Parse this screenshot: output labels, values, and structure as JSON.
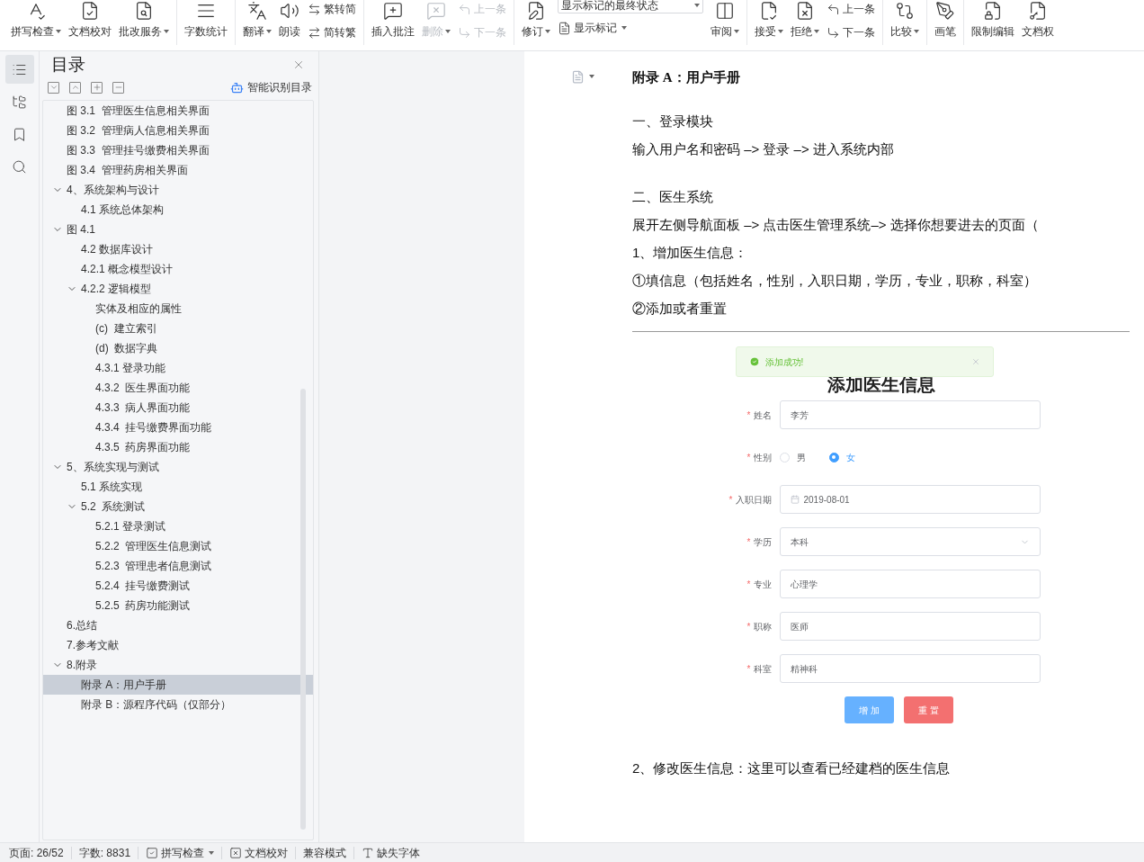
{
  "toolbar": [
    {
      "kind": "button",
      "label": "拼写检查",
      "dropdown": true,
      "disabled": false
    },
    {
      "kind": "button",
      "label": "文档校对",
      "dropdown": false,
      "disabled": false
    },
    {
      "kind": "button",
      "label": "批改服务",
      "dropdown": true,
      "disabled": false
    },
    {
      "kind": "separator"
    },
    {
      "kind": "button",
      "label": "字数统计",
      "dropdown": false,
      "disabled": false
    },
    {
      "kind": "separator"
    },
    {
      "kind": "button",
      "label": "翻译",
      "dropdown": true,
      "disabled": false
    },
    {
      "kind": "button",
      "label": "朗读",
      "dropdown": false,
      "disabled": false
    },
    {
      "kind": "stack",
      "rows": [
        {
          "kind": "small",
          "label": "繁转简",
          "dropdown": false,
          "disabled": false
        },
        {
          "kind": "small",
          "label": "简转繁",
          "dropdown": false,
          "disabled": false
        }
      ]
    },
    {
      "kind": "separator"
    },
    {
      "kind": "button",
      "label": "插入批注",
      "dropdown": false,
      "disabled": false
    },
    {
      "kind": "button",
      "label": "删除",
      "dropdown": true,
      "disabled": true
    },
    {
      "kind": "stack",
      "rows": [
        {
          "kind": "small",
          "label": "上一条",
          "dropdown": false,
          "disabled": true
        },
        {
          "kind": "small",
          "label": "下一条",
          "dropdown": false,
          "disabled": true
        }
      ]
    },
    {
      "kind": "separator"
    },
    {
      "kind": "button",
      "label": "修订",
      "dropdown": true,
      "disabled": false
    },
    {
      "kind": "stack",
      "rows": [
        {
          "kind": "select",
          "value": "显示标记的最终状态"
        },
        {
          "kind": "small",
          "label": "显示标记",
          "dropdown": true,
          "disabled": false
        }
      ]
    },
    {
      "kind": "button",
      "label": "审阅",
      "dropdown": true,
      "disabled": false
    },
    {
      "kind": "separator"
    },
    {
      "kind": "button",
      "label": "接受",
      "dropdown": true,
      "disabled": false
    },
    {
      "kind": "button",
      "label": "拒绝",
      "dropdown": true,
      "disabled": false
    },
    {
      "kind": "stack",
      "rows": [
        {
          "kind": "small",
          "label": "上一条",
          "dropdown": false,
          "disabled": false
        },
        {
          "kind": "small",
          "label": "下一条",
          "dropdown": false,
          "disabled": false
        }
      ]
    },
    {
      "kind": "separator"
    },
    {
      "kind": "button",
      "label": "比较",
      "dropdown": true,
      "disabled": false
    },
    {
      "kind": "separator"
    },
    {
      "kind": "button",
      "label": "画笔",
      "dropdown": false,
      "disabled": false
    },
    {
      "kind": "separator"
    },
    {
      "kind": "button",
      "label": "限制编辑",
      "dropdown": false,
      "disabled": false
    },
    {
      "kind": "button",
      "label": "文档权",
      "dropdown": false,
      "disabled": false
    }
  ],
  "rail": [
    {
      "selected": true
    },
    {
      "selected": false
    },
    {
      "selected": false
    },
    {
      "selected": false
    }
  ],
  "nav": {
    "title": "目录",
    "smart_link": "智能识别目录",
    "tree": [
      {
        "children": [
          {
            "label": "图 3.1  管理医生信息相关界面",
            "selected": false
          },
          {
            "label": "图 3.2  管理病人信息相关界面",
            "selected": false
          },
          {
            "label": "图 3.3  管理挂号缴费相关界面",
            "selected": false
          },
          {
            "label": "图 3.4  管理药房相关界面",
            "selected": false
          }
        ]
      },
      {
        "label": "4、系统架构与设计",
        "selected": false,
        "expanded": true,
        "children": [
          {
            "label": "4.1 系统总体架构",
            "selected": false
          }
        ]
      },
      {
        "label": "图 4.1",
        "selected": false,
        "expanded": true,
        "children": [
          {
            "label": "4.2 数据库设计",
            "selected": false
          },
          {
            "label": "4.2.1 概念模型设计",
            "selected": false
          },
          {
            "label": "4.2.2 逻辑模型",
            "selected": false,
            "expanded": true,
            "children": [
              {
                "label": "实体及相应的属性",
                "selected": false
              },
              {
                "label": "(c)  建立索引",
                "selected": false
              },
              {
                "label": "(d)  数据字典",
                "selected": false
              },
              {
                "label": "4.3.1 登录功能",
                "selected": false
              },
              {
                "label": "4.3.2  医生界面功能",
                "selected": false
              },
              {
                "label": "4.3.3  病人界面功能",
                "selected": false
              },
              {
                "label": "4.3.4  挂号缴费界面功能",
                "selected": false
              },
              {
                "label": "4.3.5  药房界面功能",
                "selected": false
              }
            ]
          }
        ]
      },
      {
        "label": "5、系统实现与测试",
        "selected": false,
        "expanded": true,
        "children": [
          {
            "label": "5.1 系统实现",
            "selected": false
          },
          {
            "label": "5.2  系统测试",
            "selected": false,
            "expanded": true,
            "children": [
              {
                "label": "5.2.1 登录测试",
                "selected": false
              },
              {
                "label": "5.2.2  管理医生信息测试",
                "selected": false
              },
              {
                "label": "5.2.3  管理患者信息测试",
                "selected": false
              },
              {
                "label": "5.2.4  挂号缴费测试",
                "selected": false
              },
              {
                "label": "5.2.5  药房功能测试",
                "selected": false
              }
            ]
          }
        ]
      },
      {
        "label": "6.总结",
        "selected": false
      },
      {
        "label": "7.参考文献",
        "selected": false
      },
      {
        "label": "8.附录",
        "selected": false,
        "expanded": true,
        "children": [
          {
            "label": "附录 A：用户手册",
            "selected": true
          },
          {
            "label": "附录 B：源程序代码（仅部分）",
            "selected": false
          }
        ]
      }
    ]
  },
  "document": {
    "heading": "附录 A：用户手册",
    "paragraphs": [
      {
        "kind": "gap",
        "text": "一、登录模块"
      },
      {
        "kind": "line",
        "text": "输入用户名和密码 –> 登录   –> 进入系统内部"
      },
      {
        "kind": "gap",
        "text": "二、医生系统"
      },
      {
        "kind": "line",
        "text": "展开左侧导航面板 –> 点击医生管理系统–> 选择你想要进去的页面（"
      },
      {
        "kind": "line",
        "text": "1、增加医生信息："
      },
      {
        "kind": "line",
        "text": "①填信息（包括姓名，性别，入职日期，学历，专业，职称，科室）"
      },
      {
        "kind": "line",
        "text": "②添加或者重置"
      }
    ],
    "form": {
      "toast": "添加成功!",
      "title": "添加医生信息",
      "fields": [
        {
          "kind": "text",
          "mark": "*",
          "label": "姓名",
          "value": "李芳"
        },
        {
          "kind": "radio",
          "mark": "*",
          "label": "性别",
          "options": [
            {
              "label": "男",
              "selected": false
            },
            {
              "label": "女",
              "selected": true
            }
          ]
        },
        {
          "kind": "date",
          "mark": "*",
          "label": "入职日期",
          "value": "2019-08-01"
        },
        {
          "kind": "select",
          "mark": "*",
          "label": "学历",
          "value": "本科"
        },
        {
          "kind": "text",
          "mark": "*",
          "label": "专业",
          "value": "心理学"
        },
        {
          "kind": "text",
          "mark": "*",
          "label": "职称",
          "value": "医师"
        },
        {
          "kind": "text",
          "mark": "*",
          "label": "科室",
          "value": "精神科"
        }
      ],
      "buttons": [
        {
          "kind": "primary",
          "label": "增 加"
        },
        {
          "kind": "danger",
          "label": "重 置"
        }
      ]
    },
    "after": "2、修改医生信息：这里可以查看已经建档的医生信息"
  },
  "status_bar": [
    {
      "kind": "text",
      "label": "页面: 26/52"
    },
    {
      "kind": "text",
      "label": "字数: 8831"
    },
    {
      "kind": "spell",
      "label": "拼写检查",
      "dropdown": true
    },
    {
      "kind": "proof",
      "label": "文档校对"
    },
    {
      "kind": "text",
      "label": "兼容模式"
    },
    {
      "kind": "font",
      "label": "缺失字体"
    }
  ]
}
